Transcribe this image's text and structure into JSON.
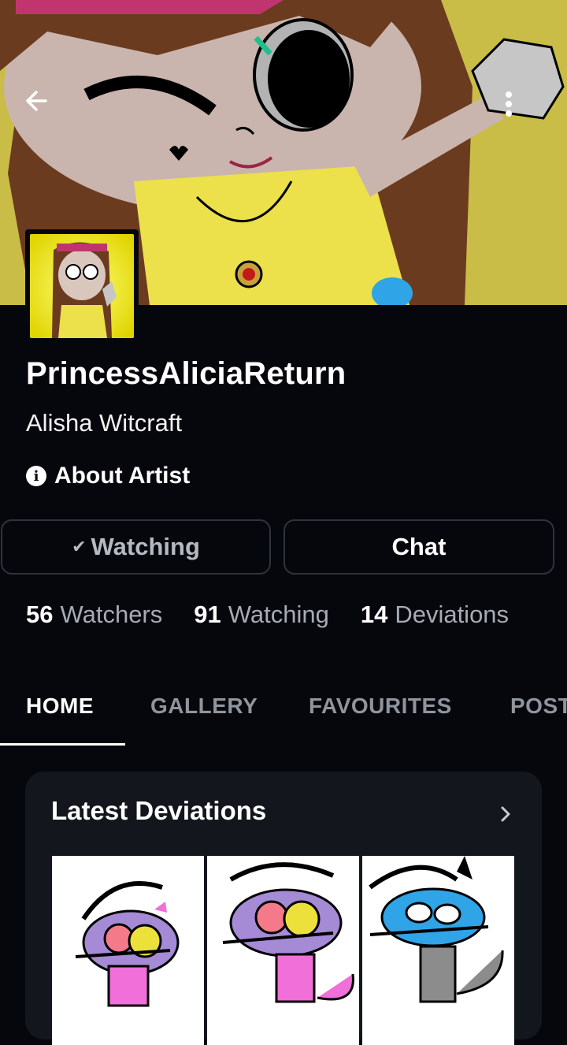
{
  "profile": {
    "username": "PrincessAliciaReturn",
    "display_name": "Alisha Witcraft",
    "about_label": "About Artist"
  },
  "actions": {
    "watch_label": "Watching",
    "chat_label": "Chat"
  },
  "stats": [
    {
      "count": "56",
      "label": "Watchers"
    },
    {
      "count": "91",
      "label": "Watching"
    },
    {
      "count": "14",
      "label": "Deviations"
    }
  ],
  "tabs": [
    {
      "label": "HOME",
      "active": true
    },
    {
      "label": "GALLERY",
      "active": false
    },
    {
      "label": "FAVOURITES",
      "active": false
    },
    {
      "label": "POSTS",
      "active": false
    }
  ],
  "latest": {
    "title": "Latest Deviations",
    "thumbnails": [
      {
        "name": "pink-bow-cat-character",
        "accent": "#f06fd9"
      },
      {
        "name": "pink-cat-character-waving",
        "accent": "#f06fd9"
      },
      {
        "name": "blue-grey-cat-character",
        "accent": "#2fa4e6"
      }
    ]
  },
  "icons": {
    "back": "arrow-left-icon",
    "more": "more-vertical-icon",
    "info": "info-icon",
    "check": "check-icon",
    "chevron": "chevron-right-icon"
  },
  "colors": {
    "background": "#06070d",
    "card": "#13161d",
    "banner": "#c9bd47",
    "muted_text": "#a6abb4"
  }
}
